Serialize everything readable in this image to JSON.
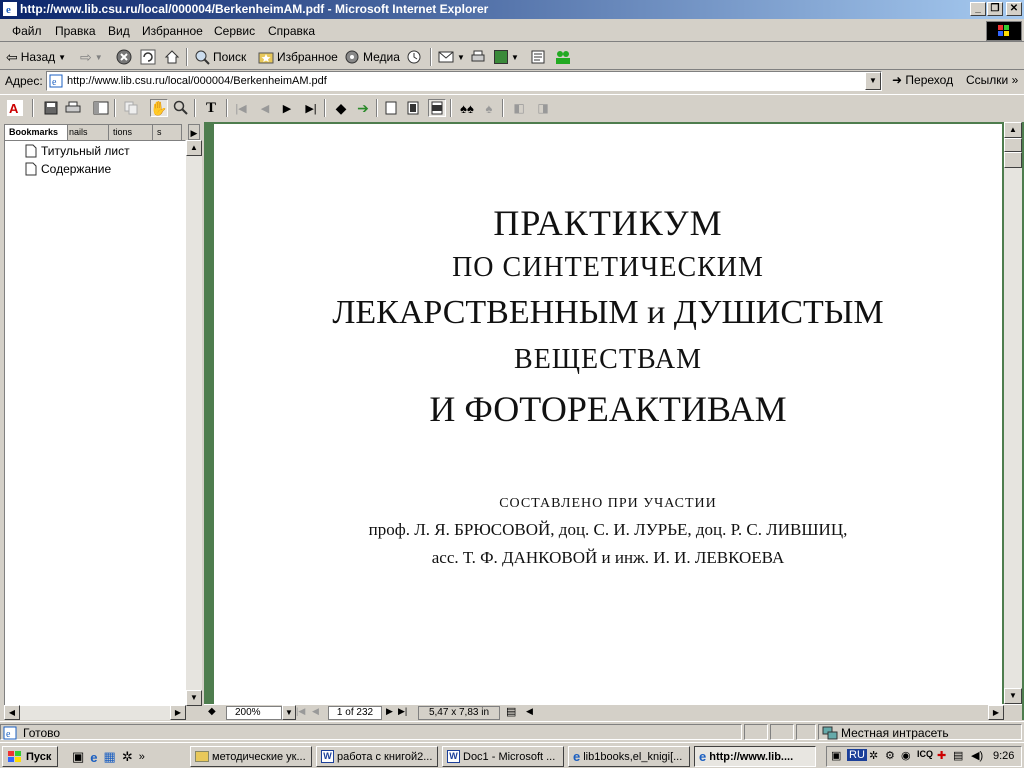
{
  "window": {
    "title": "http://www.lib.csu.ru/local/000004/BerkenheimAM.pdf - Microsoft Internet Explorer",
    "min": "_",
    "max": "❐",
    "close": "✕"
  },
  "menu": [
    "Файл",
    "Правка",
    "Вид",
    "Избранное",
    "Сервис",
    "Справка"
  ],
  "toolbar": {
    "back": "Назад",
    "search": "Поиск",
    "favorites": "Избранное",
    "media": "Медиа"
  },
  "address": {
    "label": "Адрес:",
    "url": "http://www.lib.csu.ru/local/000004/BerkenheimAM.pdf",
    "go": "Переход",
    "links": "Ссылки"
  },
  "sidebar": {
    "tabs": [
      "Bookmarks",
      "nails",
      "tions",
      "s"
    ],
    "bookmarks": [
      "Титульный лист",
      "Содержание"
    ]
  },
  "document": {
    "lines": [
      "ПРАКТИКУМ",
      "ПО СИНТЕТИЧЕСКИМ",
      "ЛЕКАРСТВЕННЫМ и ДУШИСТЫМ",
      "ВЕЩЕСТВАМ",
      "И ФОТОРЕАКТИВАМ"
    ],
    "compiled": "СОСТАВЛЕНО ПРИ УЧАСТИИ",
    "authors1": "проф. Л. Я. БРЮСОВОЙ, доц. С. И. ЛУРЬЕ, доц. Р. С. ЛИВШИЦ,",
    "authors2": "асс. Т. Ф. ДАНКОВОЙ и инж. И. И. ЛЕВКОЕВА"
  },
  "docstatus": {
    "zoom": "200%",
    "page": "1 of 232",
    "size": "5,47 x 7,83 in"
  },
  "status": {
    "text": "Готово",
    "zone": "Местная интрасеть"
  },
  "taskbar": {
    "start": "Пуск",
    "tasks": [
      "методические ук...",
      "работа с книгой2...",
      "Doc1 - Microsoft ...",
      "lib1books,el_knigi[...",
      "http://www.lib...."
    ],
    "lang": "RU",
    "clock": "9:26"
  },
  "colors": {
    "titlebar": "#0a246a",
    "docbg": "#4e7d4e",
    "chrome": "#d4d0c8"
  }
}
